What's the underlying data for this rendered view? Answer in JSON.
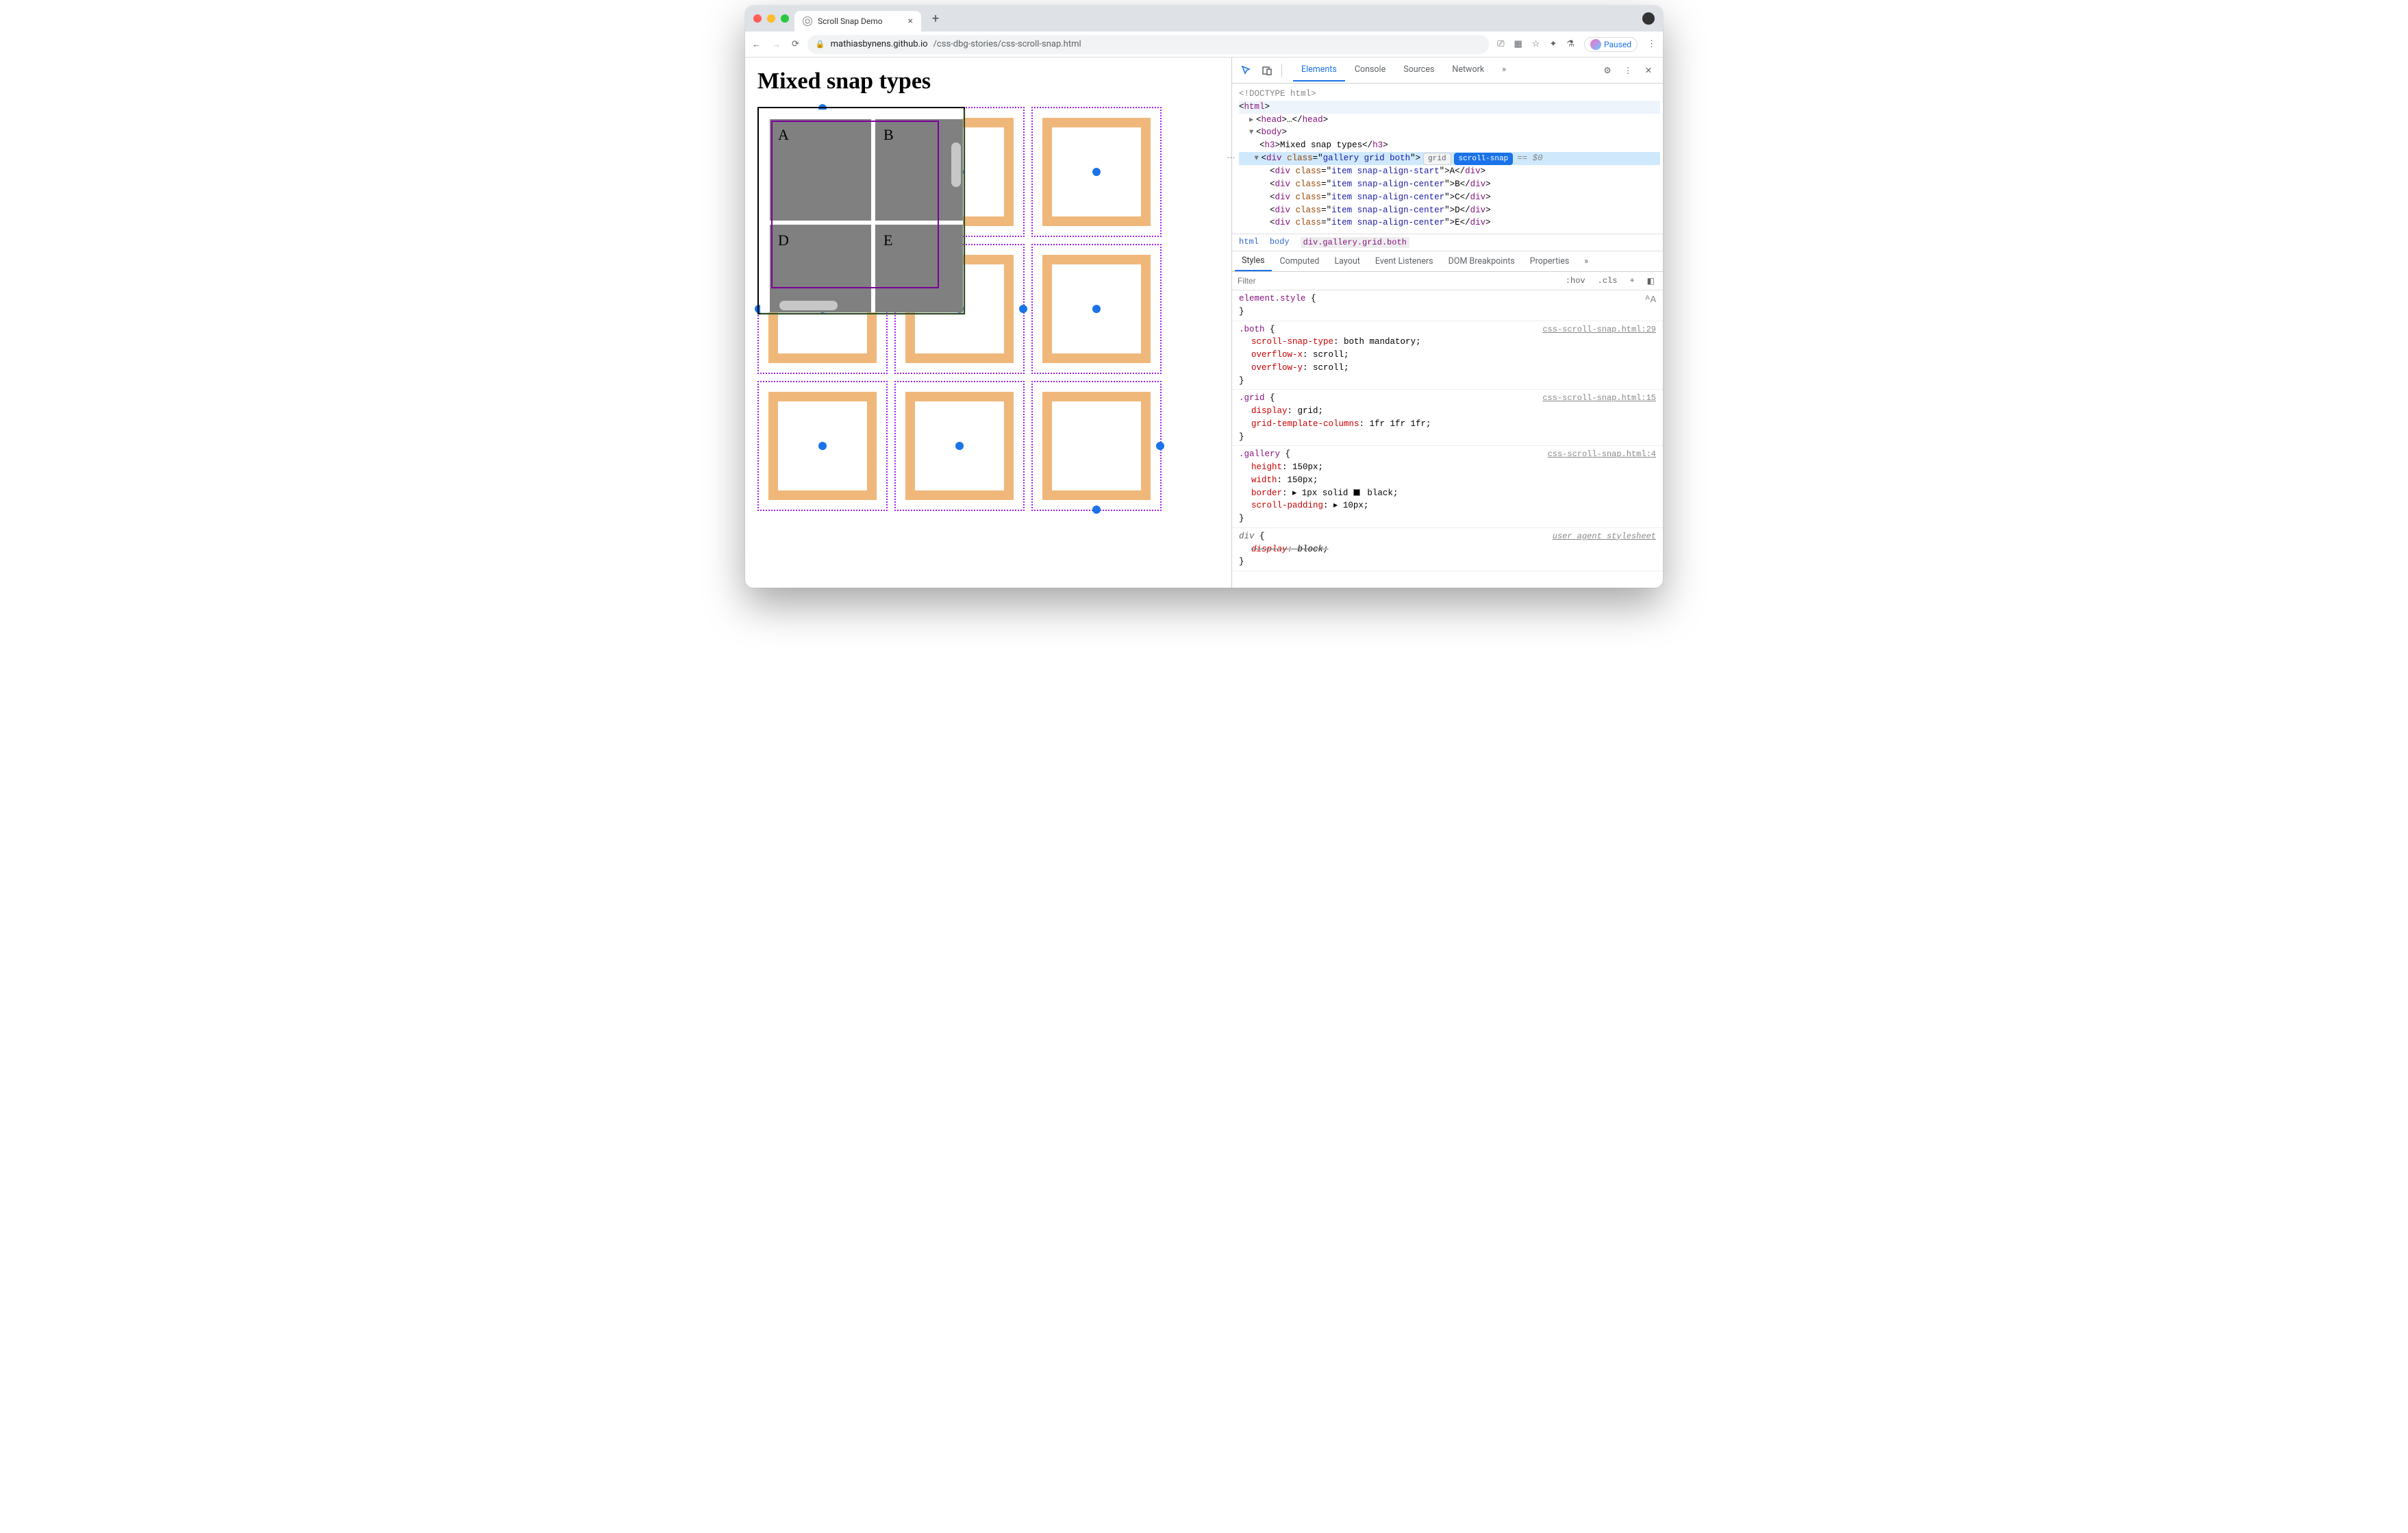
{
  "browser": {
    "tab_title": "Scroll Snap Demo",
    "new_tab_glyph": "+",
    "url_domain": "mathiasbynens.github.io",
    "url_path": "/css-dbg-stories/css-scroll-snap.html",
    "paused_label": "Paused"
  },
  "page": {
    "heading": "Mixed snap types",
    "items": [
      "A",
      "B",
      "D",
      "E"
    ]
  },
  "devtools": {
    "tabs": [
      "Elements",
      "Console",
      "Sources",
      "Network"
    ],
    "more_glyph": "»",
    "dom": {
      "doctype": "<!DOCTYPE html>",
      "html_open": "html",
      "head": "head",
      "body": "body",
      "h3_text": "Mixed snap types",
      "gallery_class": "gallery grid both",
      "badge_grid": "grid",
      "badge_snap": "scroll-snap",
      "eqvar": "== $0",
      "rows": [
        {
          "cls": "item snap-align-start",
          "t": "A"
        },
        {
          "cls": "item snap-align-center",
          "t": "B"
        },
        {
          "cls": "item snap-align-center",
          "t": "C"
        },
        {
          "cls": "item snap-align-center",
          "t": "D"
        },
        {
          "cls": "item snap-align-center",
          "t": "E"
        }
      ]
    },
    "crumbs": [
      "html",
      "body",
      "div.gallery.grid.both"
    ],
    "subtabs": [
      "Styles",
      "Computed",
      "Layout",
      "Event Listeners",
      "DOM Breakpoints",
      "Properties"
    ],
    "filter_placeholder": "Filter",
    "tools": {
      "hov": ":hov",
      "cls": ".cls",
      "plus": "+"
    },
    "rules": [
      {
        "selector": "element.style",
        "src": "",
        "decls": []
      },
      {
        "selector": ".both",
        "src": "css-scroll-snap.html:29",
        "decls": [
          {
            "p": "scroll-snap-type",
            "v": "both mandatory;"
          },
          {
            "p": "overflow-x",
            "v": "scroll;"
          },
          {
            "p": "overflow-y",
            "v": "scroll;"
          }
        ]
      },
      {
        "selector": ".grid",
        "src": "css-scroll-snap.html:15",
        "decls": [
          {
            "p": "display",
            "v": "grid;"
          },
          {
            "p": "grid-template-columns",
            "v": "1fr 1fr 1fr;"
          }
        ]
      },
      {
        "selector": ".gallery",
        "src": "css-scroll-snap.html:4",
        "decls": [
          {
            "p": "height",
            "v": "150px;"
          },
          {
            "p": "width",
            "v": "150px;"
          },
          {
            "p": "border",
            "v": "▸ 1px solid ■ black;",
            "swatch": true
          },
          {
            "p": "scroll-padding",
            "v": "▸ 10px;"
          }
        ]
      },
      {
        "selector": "div",
        "src": "user agent stylesheet",
        "ua": true,
        "decls": [
          {
            "p": "display",
            "v": "block;",
            "strike": true
          }
        ]
      }
    ]
  }
}
